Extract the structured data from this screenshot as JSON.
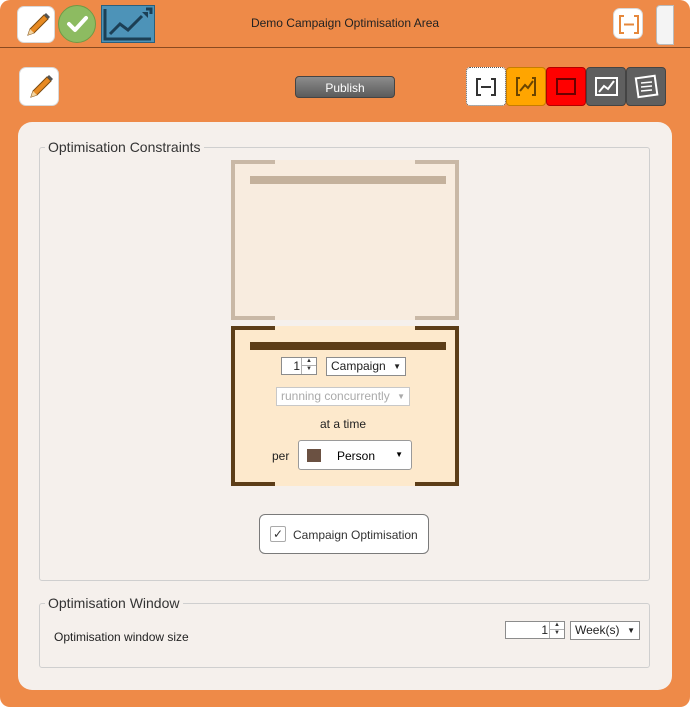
{
  "window": {
    "title": "Demo Campaign Optimisation Area"
  },
  "toolbar": {
    "publish_label": "Publish"
  },
  "constraints": {
    "legend": "Optimisation Constraints",
    "count_value": "1",
    "entity_select": "Campaign",
    "relation_select": "running concurrently",
    "at_a_time": "at a time",
    "per_label": "per",
    "per_select": "Person",
    "toggle_label": "Campaign Optimisation"
  },
  "window_section": {
    "legend": "Optimisation Window",
    "size_label": "Optimisation window size",
    "size_value": "1",
    "unit_select": "Week(s)"
  },
  "colors": {
    "accent_orange": "#ee8a48",
    "panel_bg": "#f5f0ec",
    "active_constraint_border": "#5c3d17",
    "inactive_constraint_border": "#c9b8a6",
    "mode_orange": "#ffa500",
    "mode_red": "#ff0000",
    "mode_gray": "#5f5f5f"
  }
}
